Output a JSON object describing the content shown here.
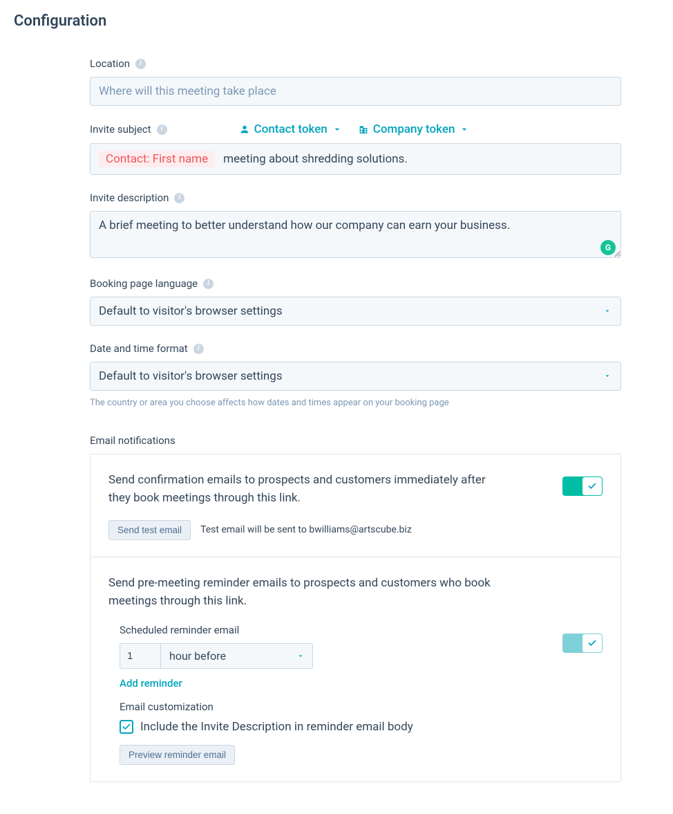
{
  "page": {
    "title": "Configuration"
  },
  "location": {
    "label": "Location",
    "placeholder": "Where will this meeting take place",
    "value": ""
  },
  "invite_subject": {
    "label": "Invite subject",
    "contact_token_label": "Contact token",
    "company_token_label": "Company token",
    "token_chip": "Contact: First name",
    "suffix_text": "meeting about shredding solutions."
  },
  "invite_description": {
    "label": "Invite description",
    "value": "A brief meeting to better understand how our company can earn your business."
  },
  "booking_language": {
    "label": "Booking page language",
    "value": "Default to visitor's browser settings"
  },
  "date_format": {
    "label": "Date and time format",
    "value": "Default to visitor's browser settings",
    "help": "The country or area you choose affects how dates and times appear on your booking page"
  },
  "email_notifications": {
    "section_label": "Email notifications",
    "confirmation": {
      "text": "Send confirmation emails to prospects and customers immediately after they book meetings through this link.",
      "toggle_on": true,
      "send_test_label": "Send test email",
      "test_note": "Test email will be sent to bwilliams@artscube.biz"
    },
    "reminder": {
      "text": "Send pre-meeting reminder emails to prospects and customers who book meetings through this link.",
      "toggle_on": true,
      "scheduled_label": "Scheduled reminder email",
      "count": "1",
      "unit": "hour before",
      "add_reminder_label": "Add reminder",
      "customization_label": "Email customization",
      "include_desc_label": "Include the Invite Description in reminder email body",
      "include_desc_checked": true,
      "preview_label": "Preview reminder email"
    }
  },
  "icons": {
    "info": "i",
    "grammarly": "G"
  }
}
